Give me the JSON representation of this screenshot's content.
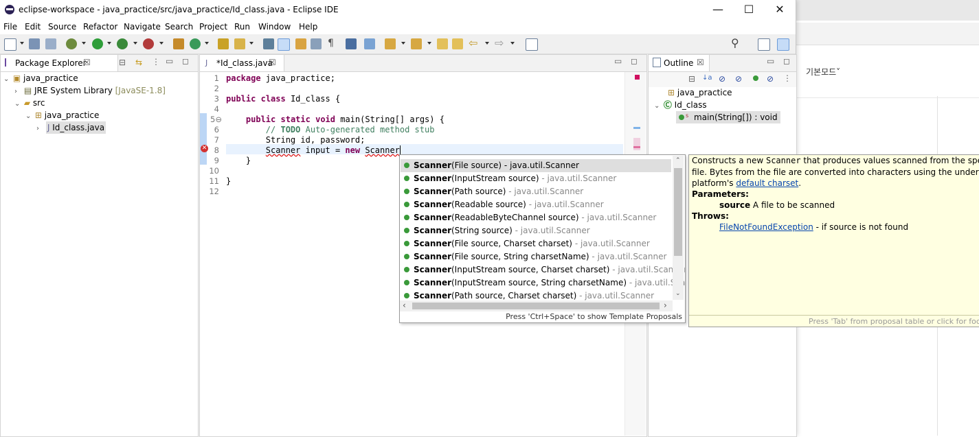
{
  "window": {
    "title": "eclipse-workspace - java_practice/src/java_practice/Id_class.java - Eclipse IDE",
    "minimize": "—",
    "maximize": "☐",
    "close": "✕"
  },
  "menu": [
    "File",
    "Edit",
    "Source",
    "Refactor",
    "Navigate",
    "Search",
    "Project",
    "Run",
    "Window",
    "Help"
  ],
  "background_window": {
    "mode_label": "기본모드˅"
  },
  "package_explorer": {
    "tab_label": "Package Explorer",
    "tab_close": "☒",
    "tree": {
      "project": "java_practice",
      "jre": "JRE System Library",
      "jre_version": "[JavaSE-1.8]",
      "src": "src",
      "package": "java_practice",
      "file": "Id_class.java"
    }
  },
  "editor": {
    "tab_label": "*Id_class.java",
    "tab_close": "☒",
    "line_numbers": [
      "1",
      "2",
      "3",
      "4",
      "5⊖",
      "6",
      "7",
      "8",
      "9",
      "10",
      "11",
      "12"
    ]
  },
  "outline": {
    "tab_label": "Outline",
    "tab_close": "☒",
    "package": "java_practice",
    "class": "Id_class",
    "method": "main(String[]) : void"
  },
  "proposals": {
    "items": [
      {
        "name": "Scanner",
        "params": "(File source)",
        "qualifier": " - java.util.Scanner"
      },
      {
        "name": "Scanner",
        "params": "(InputStream source)",
        "qualifier": " - java.util.Scanner"
      },
      {
        "name": "Scanner",
        "params": "(Path source)",
        "qualifier": " - java.util.Scanner"
      },
      {
        "name": "Scanner",
        "params": "(Readable source)",
        "qualifier": " - java.util.Scanner"
      },
      {
        "name": "Scanner",
        "params": "(ReadableByteChannel source)",
        "qualifier": " - java.util.Scanner"
      },
      {
        "name": "Scanner",
        "params": "(String source)",
        "qualifier": " - java.util.Scanner"
      },
      {
        "name": "Scanner",
        "params": "(File source, Charset charset)",
        "qualifier": " - java.util.Scanner"
      },
      {
        "name": "Scanner",
        "params": "(File source, String charsetName)",
        "qualifier": " - java.util.Scanner"
      },
      {
        "name": "Scanner",
        "params": "(InputStream source, Charset charset)",
        "qualifier": " - java.util.Scanner"
      },
      {
        "name": "Scanner",
        "params": "(InputStream source, String charsetName)",
        "qualifier": " - java.util.Scanner"
      },
      {
        "name": "Scanner",
        "params": "(Path source, Charset charset)",
        "qualifier": " - java.util.Scanner"
      }
    ],
    "footer": "Press 'Ctrl+Space' to show Template Proposals"
  },
  "doc": {
    "line1_a": "Constructs a new ",
    "line1_code": "Scanner",
    "line1_b": " that produces values scanned from the specified",
    "line2": "file. Bytes from the file are converted into characters using the underlying",
    "line3_a": "platform's ",
    "line3_link": "default charset",
    "line3_b": ".",
    "params_heading": "Parameters:",
    "param_name": "source",
    "param_desc": " A file to be scanned",
    "throws_heading": "Throws:",
    "throws_link": "FileNotFoundException",
    "throws_desc": " - if source is not found",
    "footer": "Press 'Tab' from proposal table or click for focus"
  },
  "colors": {
    "keyword": "#7f0055",
    "comment": "#3f7f5f",
    "field": "#0000c0",
    "doc_bg": "#ffffe1"
  }
}
